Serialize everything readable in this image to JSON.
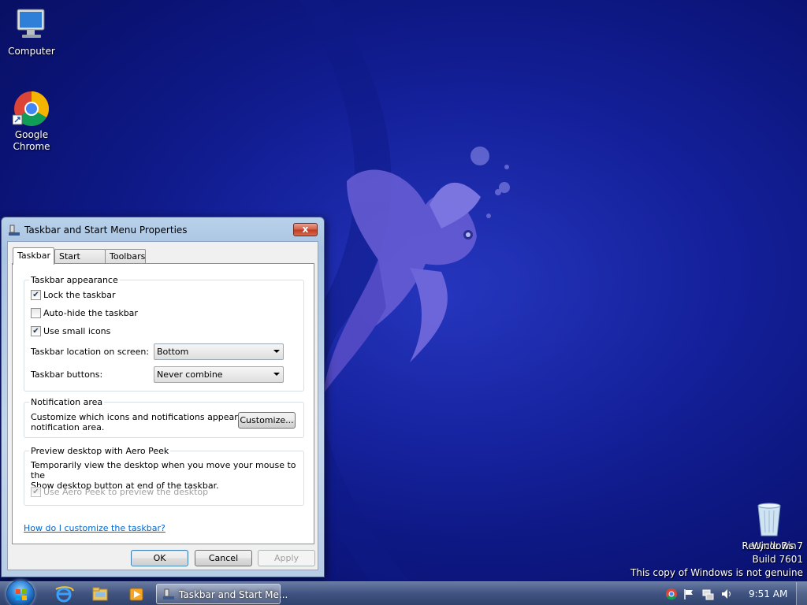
{
  "desktop": {
    "icons": [
      {
        "label": "Computer",
        "icon": "computer-icon"
      },
      {
        "label": "Google Chrome",
        "label_line1": "Google",
        "label_line2": "Chrome",
        "icon": "chrome-icon"
      },
      {
        "label": "Recycle Bin",
        "icon": "recycle-bin-icon"
      }
    ],
    "watermark": {
      "line1": "Windows 7",
      "line2": "Build 7601",
      "line3": "This copy of Windows is not genuine"
    }
  },
  "dialog": {
    "title": "Taskbar and Start Menu Properties",
    "close_label": "x",
    "tabs": [
      {
        "label": "Taskbar",
        "active": true
      },
      {
        "label": "Start Menu",
        "active": false
      },
      {
        "label": "Toolbars",
        "active": false
      }
    ],
    "appearance": {
      "heading": "Taskbar appearance",
      "lock": {
        "label": "Lock the taskbar",
        "checked": true
      },
      "autohide": {
        "label": "Auto-hide the taskbar",
        "checked": false
      },
      "small_icons": {
        "label": "Use small icons",
        "checked": true
      },
      "location_label": "Taskbar location on screen:",
      "location_value": "Bottom",
      "buttons_label": "Taskbar buttons:",
      "buttons_value": "Never combine"
    },
    "notification": {
      "heading": "Notification area",
      "desc_line1": "Customize which icons and notifications appear in the",
      "desc_line2": "notification area.",
      "customize_label": "Customize..."
    },
    "aero": {
      "heading": "Preview desktop with Aero Peek",
      "desc_line1": "Temporarily view the desktop when you move your mouse to the",
      "desc_line2": "Show desktop button at end of the taskbar.",
      "peek": {
        "label": "Use Aero Peek to preview the desktop",
        "checked": true,
        "disabled": true
      }
    },
    "help_link": "How do I customize the taskbar?",
    "buttons": {
      "ok": "OK",
      "cancel": "Cancel",
      "apply": "Apply"
    }
  },
  "taskbar": {
    "pinned": [
      "internet-explorer-icon",
      "windows-explorer-icon",
      "media-player-icon"
    ],
    "active_task": "Taskbar and Start Me...",
    "tray_icons": [
      "chrome-tray-icon",
      "action-center-flag-icon",
      "network-icon",
      "volume-icon"
    ],
    "clock": "9:51 AM"
  },
  "colors": {
    "desktop_blue": "#14209a",
    "fish_purple": "#6a5fd6",
    "link_blue": "#0066cc"
  }
}
